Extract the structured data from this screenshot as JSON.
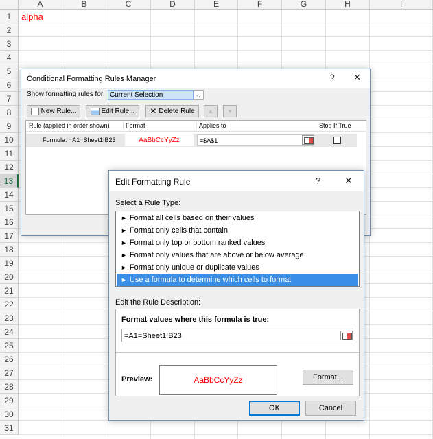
{
  "sheet": {
    "columns": [
      "A",
      "B",
      "C",
      "D",
      "E",
      "F",
      "G",
      "H",
      "I"
    ],
    "rows": [
      "1",
      "2",
      "3",
      "4",
      "5",
      "6",
      "7",
      "8",
      "9",
      "10",
      "11",
      "12",
      "13",
      "14",
      "15",
      "16",
      "17",
      "18",
      "19",
      "20",
      "21",
      "22",
      "23",
      "24",
      "25",
      "26",
      "27",
      "28",
      "29",
      "30",
      "31"
    ],
    "selected_row": "13",
    "a1_value": "alpha",
    "a1_color": "#ff0000"
  },
  "cfm": {
    "title": "Conditional Formatting Rules Manager",
    "help": "?",
    "close": "✕",
    "show_label": "Show formatting rules for:",
    "show_value": "Current Selection",
    "new_rule": "New Rule...",
    "edit_rule": "Edit Rule...",
    "delete_rule": "Delete Rule",
    "up": "▲",
    "down": "▼",
    "headers": {
      "rule": "Rule (applied in order shown)",
      "format": "Format",
      "applies": "Applies to",
      "stop": "Stop If True"
    },
    "row": {
      "rule": "Formula: =A1=Sheet1!B23",
      "format": "AaBbCcYyZz",
      "applies": "=$A$1"
    }
  },
  "efr": {
    "title": "Edit Formatting Rule",
    "help": "?",
    "close": "✕",
    "select_type_label": "Select a Rule Type:",
    "types": [
      "Format all cells based on their values",
      "Format only cells that contain",
      "Format only top or bottom ranked values",
      "Format only values that are above or below average",
      "Format only unique or duplicate values",
      "Use a formula to determine which cells to format"
    ],
    "selected_type_index": 5,
    "bullet": "►",
    "desc_label": "Edit the Rule Description:",
    "formula_label": "Format values where this formula is true:",
    "formula_value": "=A1=Sheet1!B23",
    "preview_label": "Preview:",
    "preview_text": "AaBbCcYyZz",
    "preview_color": "#ff0000",
    "format_button": "Format...",
    "ok": "OK",
    "cancel": "Cancel"
  }
}
